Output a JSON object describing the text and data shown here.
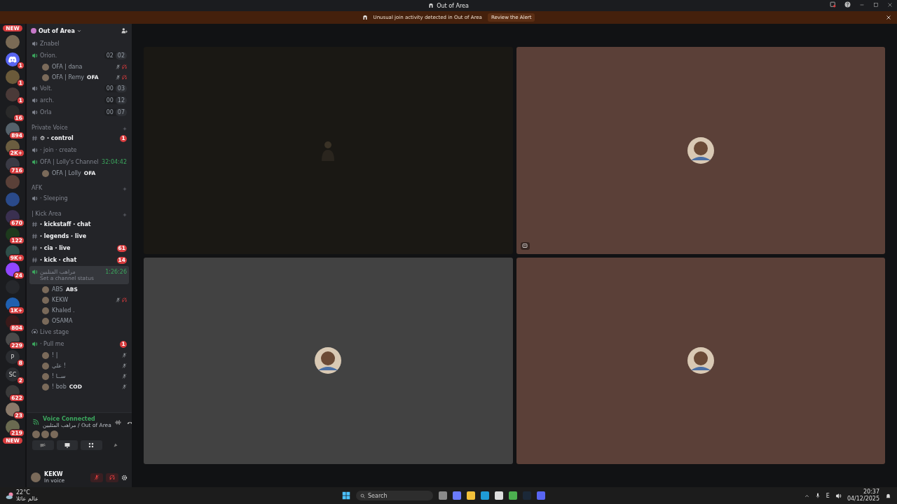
{
  "window": {
    "title": "Out of Area"
  },
  "banner": {
    "message": "Unusual join activity detected in Out of Area",
    "action": "Review the Alert"
  },
  "servers": [
    {
      "badge": "NEW",
      "color": "#7a6a55"
    },
    {
      "badge": "1",
      "color": "#5865f2",
      "kind": "discord"
    },
    {
      "badge": "1",
      "color": "#6b5a3a"
    },
    {
      "badge": "1",
      "color": "#4a3a38"
    },
    {
      "badge": "16",
      "color": "#2a2a2a"
    },
    {
      "badge": "894",
      "color": "#55626b"
    },
    {
      "badge": "2K+",
      "color": "#6b5d40"
    },
    {
      "badge": "716",
      "color": "#3a3a44"
    },
    {
      "color": "#5a4038"
    },
    {
      "color": "#2a4a8a"
    },
    {
      "badge": "670",
      "color": "#3a3050"
    },
    {
      "badge": "122",
      "color": "#1d3a1d"
    },
    {
      "badge": "9K+",
      "color": "#2f4f4a"
    },
    {
      "badge": "24",
      "color": "#9146ff"
    },
    {
      "color": "#26282c"
    },
    {
      "badge": "1K+",
      "color": "#2060b0"
    },
    {
      "badge": "804",
      "color": "#3a1a1a"
    },
    {
      "badge": "229",
      "color": "#4a4a4a"
    },
    {
      "badge": "8",
      "color": "#2b2d31",
      "label": "P"
    },
    {
      "badge": "2",
      "color": "#2b2d31",
      "label": "SC"
    },
    {
      "badge": "622",
      "color": "#3a3a3a"
    },
    {
      "badge": "23",
      "color": "#8a7a6a"
    },
    {
      "badge": "219",
      "color": "#6a6a50"
    }
  ],
  "server_bottom_badge": "NEW",
  "server": {
    "name": "Out of Area"
  },
  "channels": [
    {
      "kind": "voice",
      "name": "Znabel",
      "connected": false
    },
    {
      "kind": "voice",
      "name": "Orion.",
      "connected": true,
      "counts": [
        "02",
        "02"
      ],
      "children": [
        {
          "name": "OFA | dana",
          "muted": true,
          "deafened": true
        },
        {
          "name": "OFA | Remy",
          "tag": "OFA",
          "muted": true,
          "deafened": true
        }
      ]
    },
    {
      "kind": "voice",
      "name": "Volt.",
      "connected": false,
      "counts": [
        "00",
        "03"
      ]
    },
    {
      "kind": "voice",
      "name": "arch.",
      "connected": false,
      "counts": [
        "00",
        "12"
      ]
    },
    {
      "kind": "voice",
      "name": "Orla",
      "connected": false,
      "counts": [
        "00",
        "07"
      ]
    },
    {
      "kind": "category",
      "name": "Private Voice"
    },
    {
      "kind": "text",
      "name": "⚙ · control",
      "unread": true,
      "badge": "1"
    },
    {
      "kind": "voice",
      "name": "· join · create",
      "connected": false
    },
    {
      "kind": "voice",
      "name": "OFA | Lolly's Channel",
      "connected": true,
      "timer": "32:04:42",
      "children": [
        {
          "name": "OFA | Lolly",
          "tag": "OFA",
          "muted": false,
          "deafened": false
        }
      ]
    },
    {
      "kind": "category",
      "name": "AFK"
    },
    {
      "kind": "voice",
      "name": "· Sleeping",
      "connected": false
    },
    {
      "kind": "category",
      "name": "| Kick Area"
    },
    {
      "kind": "text",
      "name": "· kickstaff · chat",
      "unread": true
    },
    {
      "kind": "text",
      "name": "· legends · live",
      "unread": true
    },
    {
      "kind": "text",
      "name": "· cia · live",
      "unread": true,
      "badge": "61"
    },
    {
      "kind": "text",
      "name": "· kick · chat",
      "unread": true,
      "badge": "14"
    },
    {
      "kind": "voice",
      "name": "مراهب المتلبين",
      "connected": true,
      "selected": true,
      "timer": "1:26:26",
      "status": "Set a channel status",
      "children": [
        {
          "name": "ABS",
          "tag": "ABS",
          "muted": false,
          "deafened": false
        },
        {
          "name": "KEKW",
          "muted": true,
          "deafened": true
        },
        {
          "name": "Khaled .",
          "muted": false,
          "deafened": false
        },
        {
          "name": "OSAMA",
          "muted": false,
          "deafened": false
        }
      ]
    },
    {
      "kind": "stage",
      "name": "Live stage"
    },
    {
      "kind": "voice",
      "name": "· Pull me",
      "connected": true,
      "badge": "1",
      "children": [
        {
          "name": "! |",
          "muted": true,
          "deafened": false
        },
        {
          "name": "علي !",
          "muted": true,
          "deafened": false
        },
        {
          "name": "! ســا",
          "muted": true,
          "deafened": false
        },
        {
          "name": "! bob",
          "tag": "COD",
          "muted": true,
          "deafened": false
        }
      ]
    }
  ],
  "voice_panel": {
    "status": "Voice Connected",
    "location": "مراهب المتلبين / Out of Area"
  },
  "user_panel": {
    "name": "KEKW",
    "status": "In voice",
    "muted": true,
    "deafened": true
  },
  "tiles": [
    {
      "kind": "figure",
      "color": "#1a1814"
    },
    {
      "kind": "avatar",
      "color": "#5b4038",
      "fit_icon": true
    },
    {
      "kind": "avatar",
      "color": "#424242"
    },
    {
      "kind": "avatar",
      "color": "#5b4038"
    }
  ],
  "taskbar": {
    "weather": "22°C",
    "weather_note": "عالم عائلا",
    "search": "Search",
    "language": "E",
    "time": "20:37",
    "date": "04/12/2025"
  }
}
